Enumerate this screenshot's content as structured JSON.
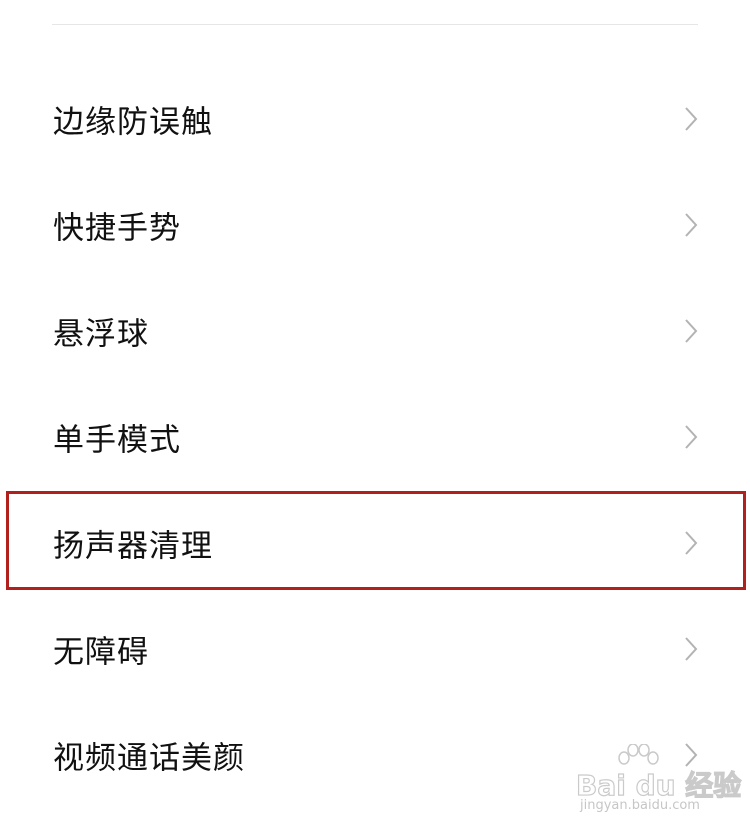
{
  "settings": {
    "items": [
      {
        "label": "边缘防误触"
      },
      {
        "label": "快捷手势"
      },
      {
        "label": "悬浮球"
      },
      {
        "label": "单手模式"
      },
      {
        "label": "扬声器清理"
      },
      {
        "label": "无障碍"
      },
      {
        "label": "视频通话美颜"
      }
    ],
    "highlighted_item": "扬声器清理",
    "highlight_color": "#b1201d"
  },
  "watermark": {
    "brand": "Bai du 经验",
    "url": "jingyan.baidu.com"
  }
}
